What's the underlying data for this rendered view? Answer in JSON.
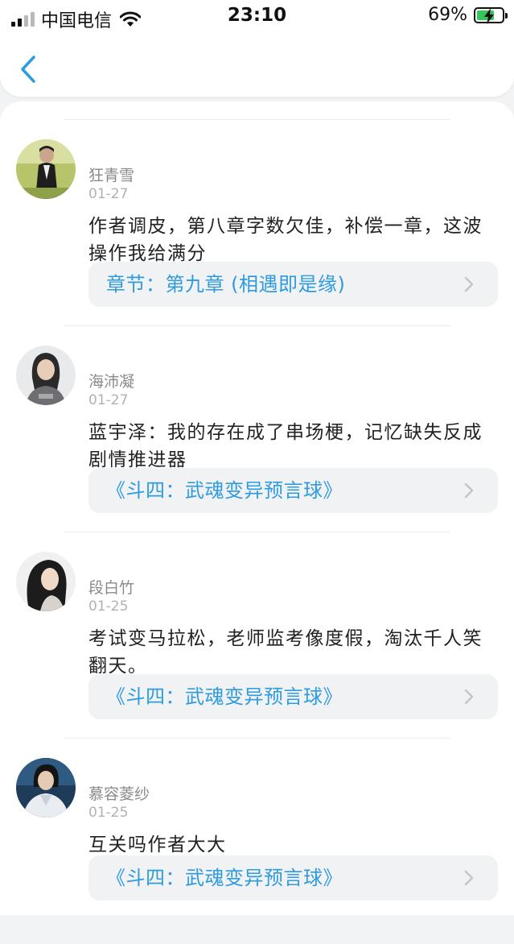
{
  "status_bar": {
    "carrier": "中国电信",
    "time": "23:10",
    "battery_text": "69%",
    "battery_level": 0.69,
    "signal_bars_active": 2,
    "signal_bars_total": 4
  },
  "nav": {
    "back_icon": "chevron-left-icon"
  },
  "colors": {
    "accent": "#2f9bdf",
    "link_bg": "#f1f2f4",
    "battery_green": "#34c759"
  },
  "comments": [
    {
      "user": "狂青雪",
      "date": "01-27",
      "text": "作者调皮，第八章字数欠佳，补偿一章，这波操作我给满分",
      "link": "章节：第九章 (相遇即是缘)"
    },
    {
      "user": "海沛凝",
      "date": "01-27",
      "text": "蓝宇泽：我的存在成了串场梗，记忆缺失反成剧情推进器",
      "link": "《斗四：武魂变异预言球》"
    },
    {
      "user": "段白竹",
      "date": "01-25",
      "text": "考试变马拉松，老师监考像度假，淘汰千人笑翻天。",
      "link": "《斗四：武魂变异预言球》"
    },
    {
      "user": "慕容菱纱",
      "date": "01-25",
      "text": "互关吗作者大大",
      "link": "《斗四：武魂变异预言球》"
    }
  ]
}
